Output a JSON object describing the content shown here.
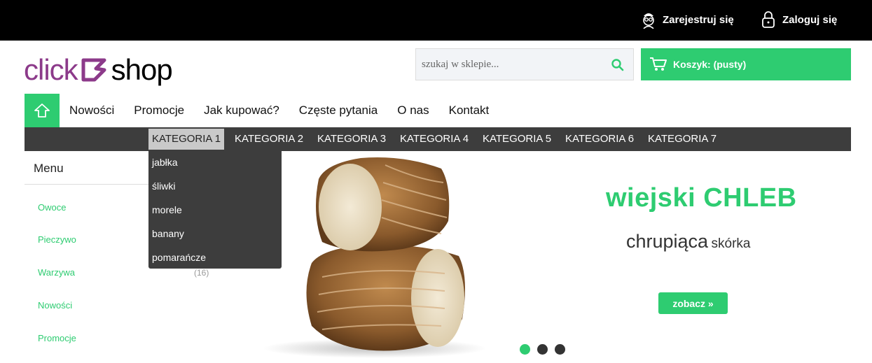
{
  "top": {
    "register_label": "Zarejestruj się",
    "login_label": "Zaloguj się",
    "register_icon": "user-glasses-icon",
    "login_icon": "lock-icon"
  },
  "logo": {
    "part1": "click",
    "part2": "shop"
  },
  "search": {
    "placeholder": "szukaj w sklepie..."
  },
  "cart": {
    "label": "Koszyk: (pusty)"
  },
  "nav": {
    "items": [
      "Nowości",
      "Promocje",
      "Jak kupować?",
      "Częste pytania",
      "O nas",
      "Kontakt"
    ]
  },
  "categories": [
    "KATEGORIA 1",
    "KATEGORIA 2",
    "KATEGORIA 3",
    "KATEGORIA 4",
    "KATEGORIA 5",
    "KATEGORIA 6",
    "KATEGORIA 7"
  ],
  "dropdown": [
    "jabłka",
    "śliwki",
    "morele",
    "banany",
    "pomarańcze"
  ],
  "sidebar": {
    "title": "Menu",
    "items": [
      "Owoce",
      "Pieczywo",
      "Warzywa",
      "Nowości",
      "Promocje"
    ],
    "warzywa_count": "(16)"
  },
  "banner": {
    "title": "wiejski CHLEB",
    "subtitle_big": "chrupiąca",
    "subtitle_small": "skórka",
    "button": "zobacz »"
  },
  "colors": {
    "accent": "#2ecc71",
    "brand": "#8c3a8a",
    "dark": "#3d3d3d"
  }
}
